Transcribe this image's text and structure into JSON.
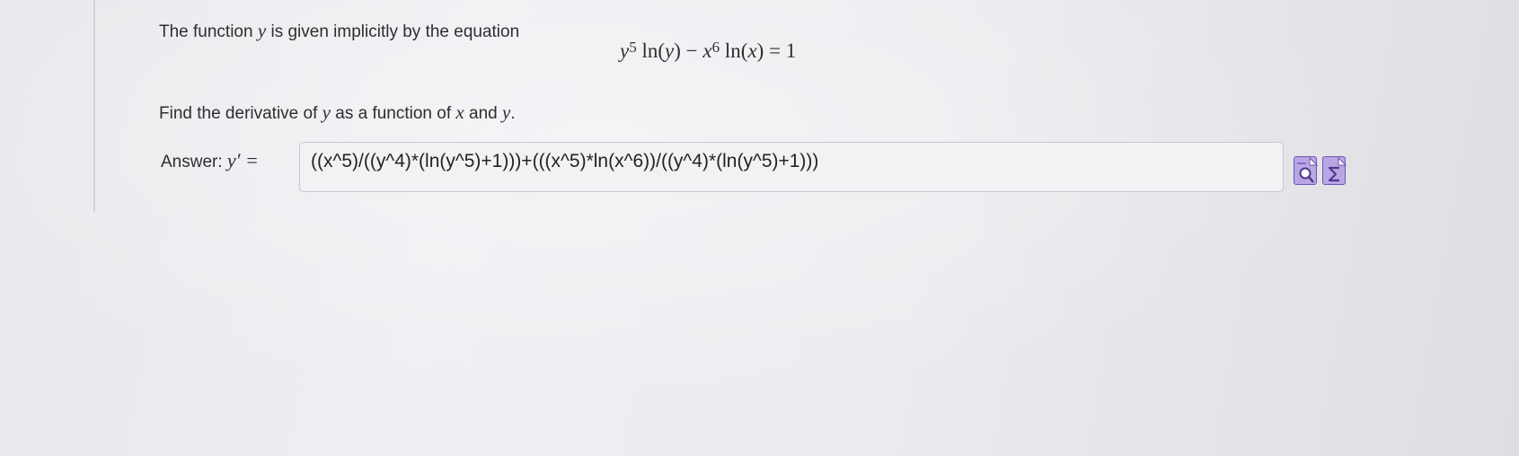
{
  "question": {
    "intro_prefix": "The function",
    "intro_var": "y",
    "intro_suffix": "is given implicitly by the equation",
    "equation": {
      "term1_base": "y",
      "term1_exp": "5",
      "term1_fn": "ln(",
      "term1_arg": "y",
      "term1_close": ")",
      "minus": "−",
      "term2_base": "x",
      "term2_exp": "6",
      "term2_fn": "ln(",
      "term2_arg": "x",
      "term2_close": ")",
      "equals_rhs": "= 1"
    },
    "find_prefix": "Find the derivative of",
    "find_var1": "y",
    "find_mid": "as a function of",
    "find_var2": "x",
    "find_and": "and",
    "find_var3": "y",
    "find_period": "."
  },
  "answer": {
    "label": "Answer:",
    "label_math": "y′ =",
    "value": "((x^5)/((y^4)*(ln(y^5)+1)))+(((x^5)*ln(x^6))/((y^4)*(ln(y^5)+1)))"
  },
  "tools": {
    "preview_icon": "preview-icon",
    "equation_editor_icon": "sigma-equation-icon",
    "accent_color": "#b9a6e4",
    "border_color": "#6d55b5"
  }
}
